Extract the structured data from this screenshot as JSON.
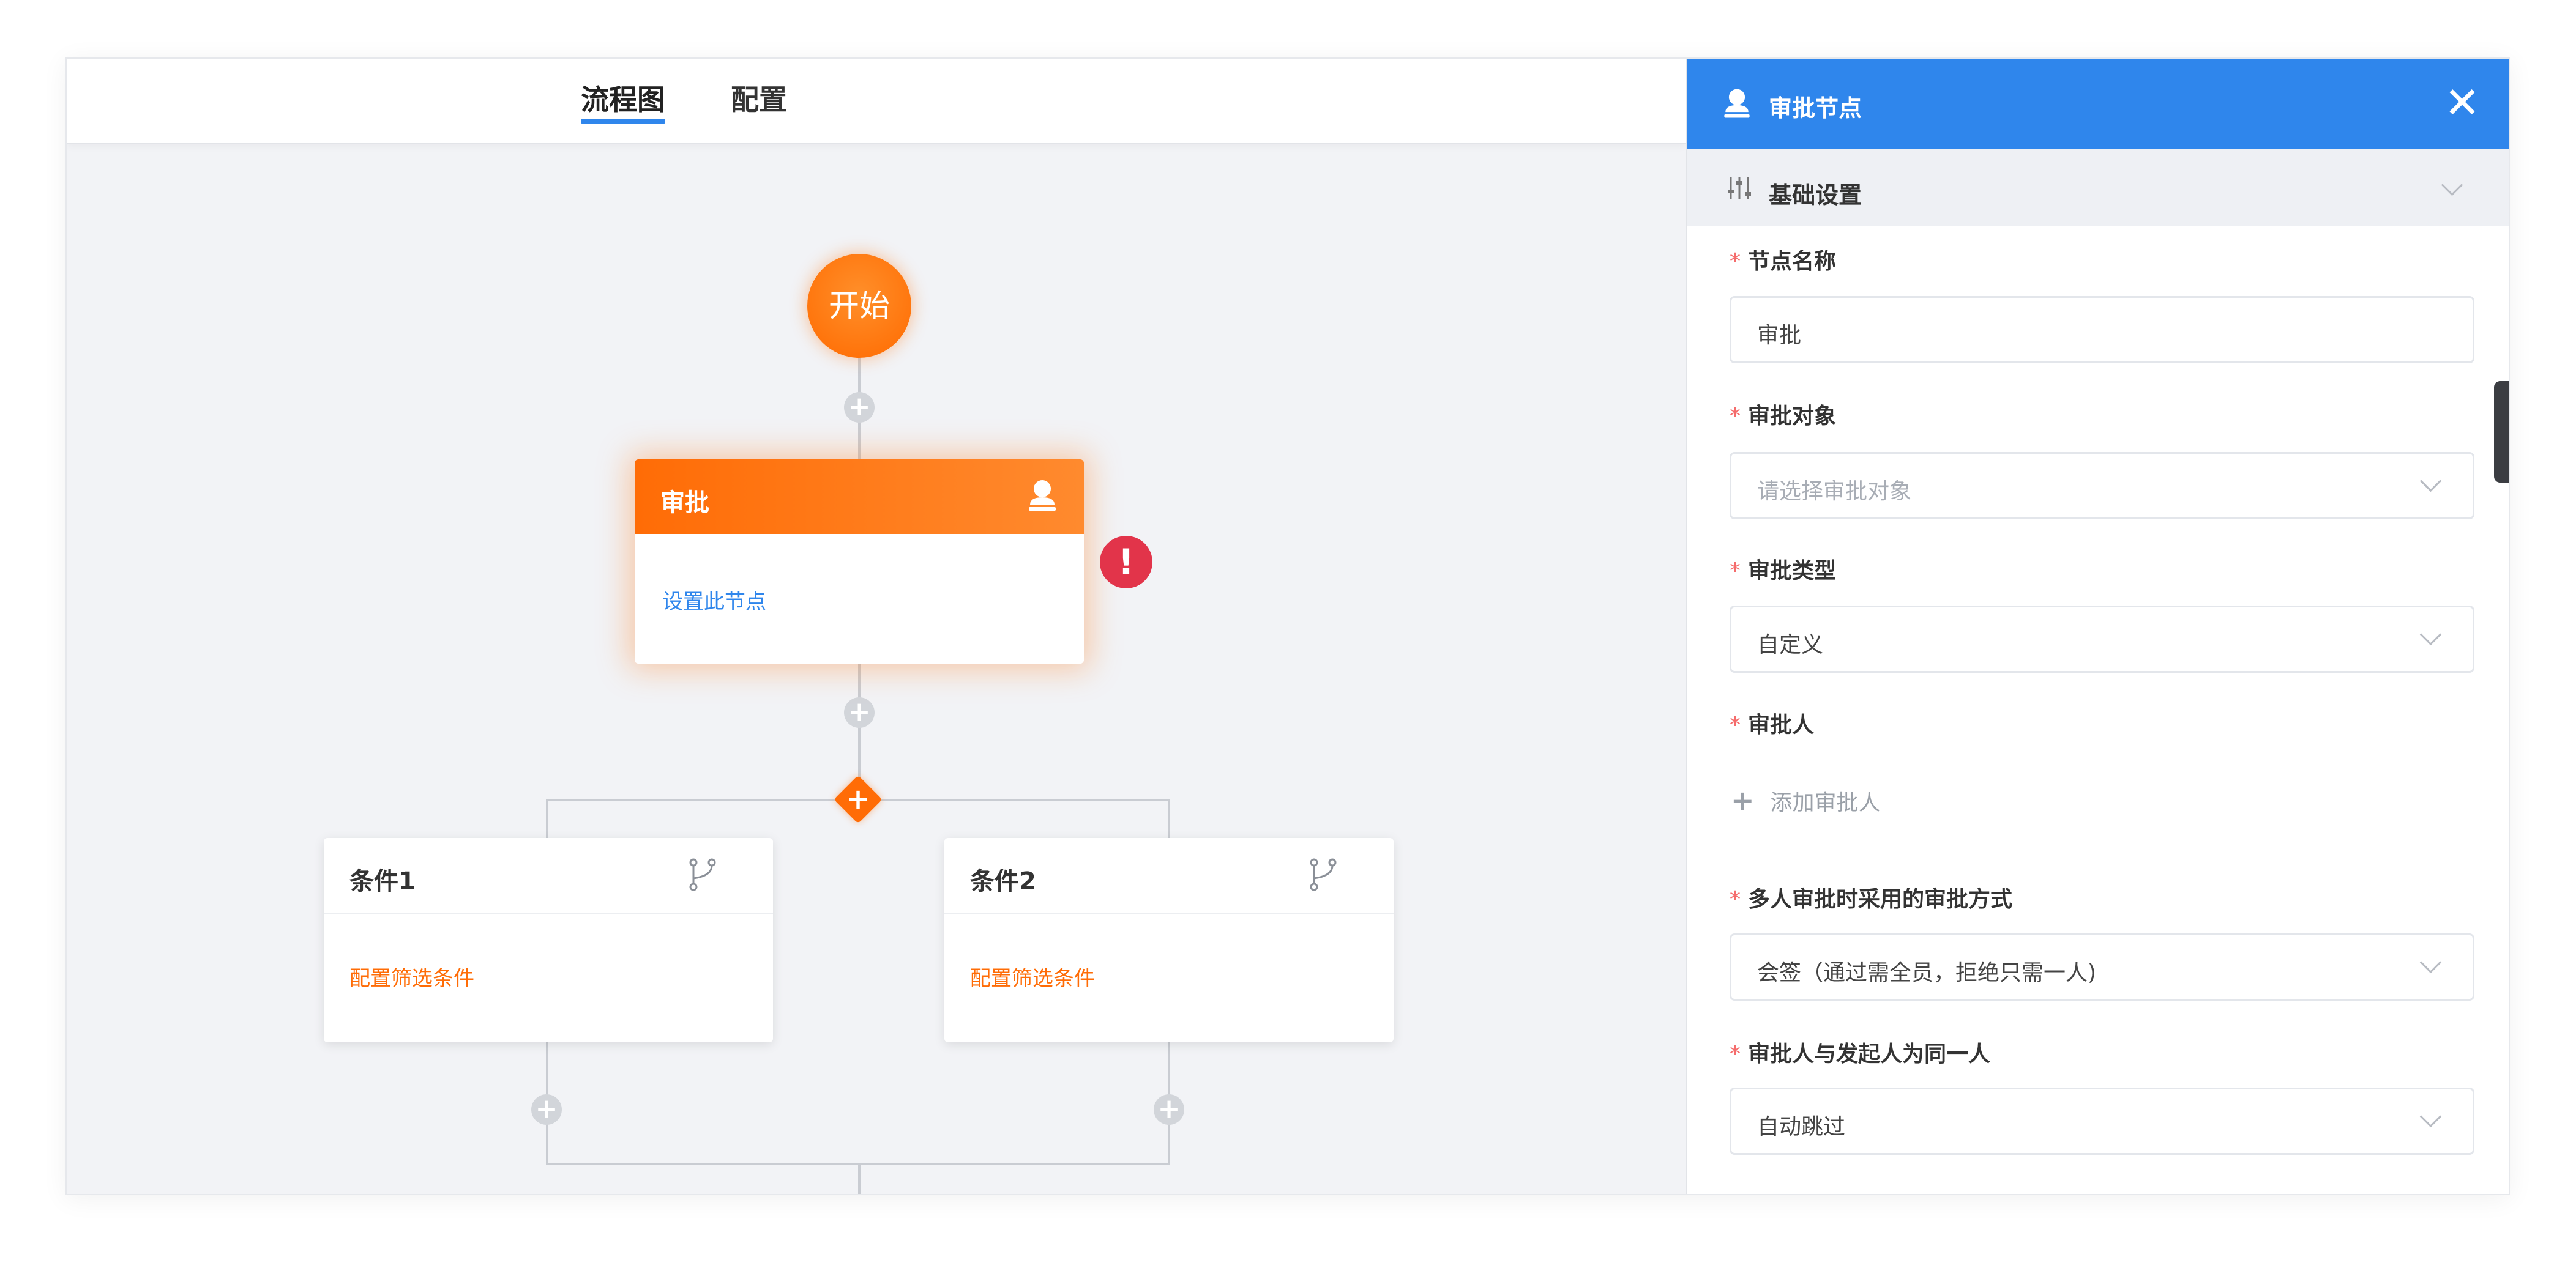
{
  "tabs": [
    {
      "label": "流程图",
      "active": true
    },
    {
      "label": "配置",
      "active": false
    }
  ],
  "flow": {
    "start_label": "开始",
    "approve_node": {
      "title": "审批",
      "body": "设置此节点",
      "icon": "person-stamp-icon",
      "error_icon": "exclamation-icon",
      "error_symbol": "!"
    },
    "branch_symbol": "+",
    "add_symbol": "+",
    "conditions": [
      {
        "title": "条件1",
        "body": "配置筛选条件",
        "icon": "branch-icon"
      },
      {
        "title": "条件2",
        "body": "配置筛选条件",
        "icon": "branch-icon"
      }
    ]
  },
  "panel": {
    "title": "审批节点",
    "title_icon": "person-stamp-icon",
    "close_symbol": "✕",
    "section": {
      "title": "基础设置",
      "icon": "sliders-icon"
    },
    "required_mark": "*",
    "fields": {
      "node_name": {
        "label": "节点名称",
        "value": "审批"
      },
      "approve_target": {
        "label": "审批对象",
        "placeholder": "请选择审批对象"
      },
      "approve_type": {
        "label": "审批类型",
        "value": "自定义"
      },
      "approver": {
        "label": "审批人",
        "add_text": "添加审批人",
        "add_symbol": "+"
      },
      "multi_mode": {
        "label": "多人审批时采用的审批方式",
        "value": "会签（通过需全员，拒绝只需一人)"
      },
      "same_person": {
        "label": "审批人与发起人为同一人",
        "value": "自动跳过"
      }
    }
  },
  "colors": {
    "accent_blue": "#2f86ec",
    "accent_orange": "#ff6c06",
    "error_red": "#e2344a",
    "required_red": "#f56c6c"
  }
}
